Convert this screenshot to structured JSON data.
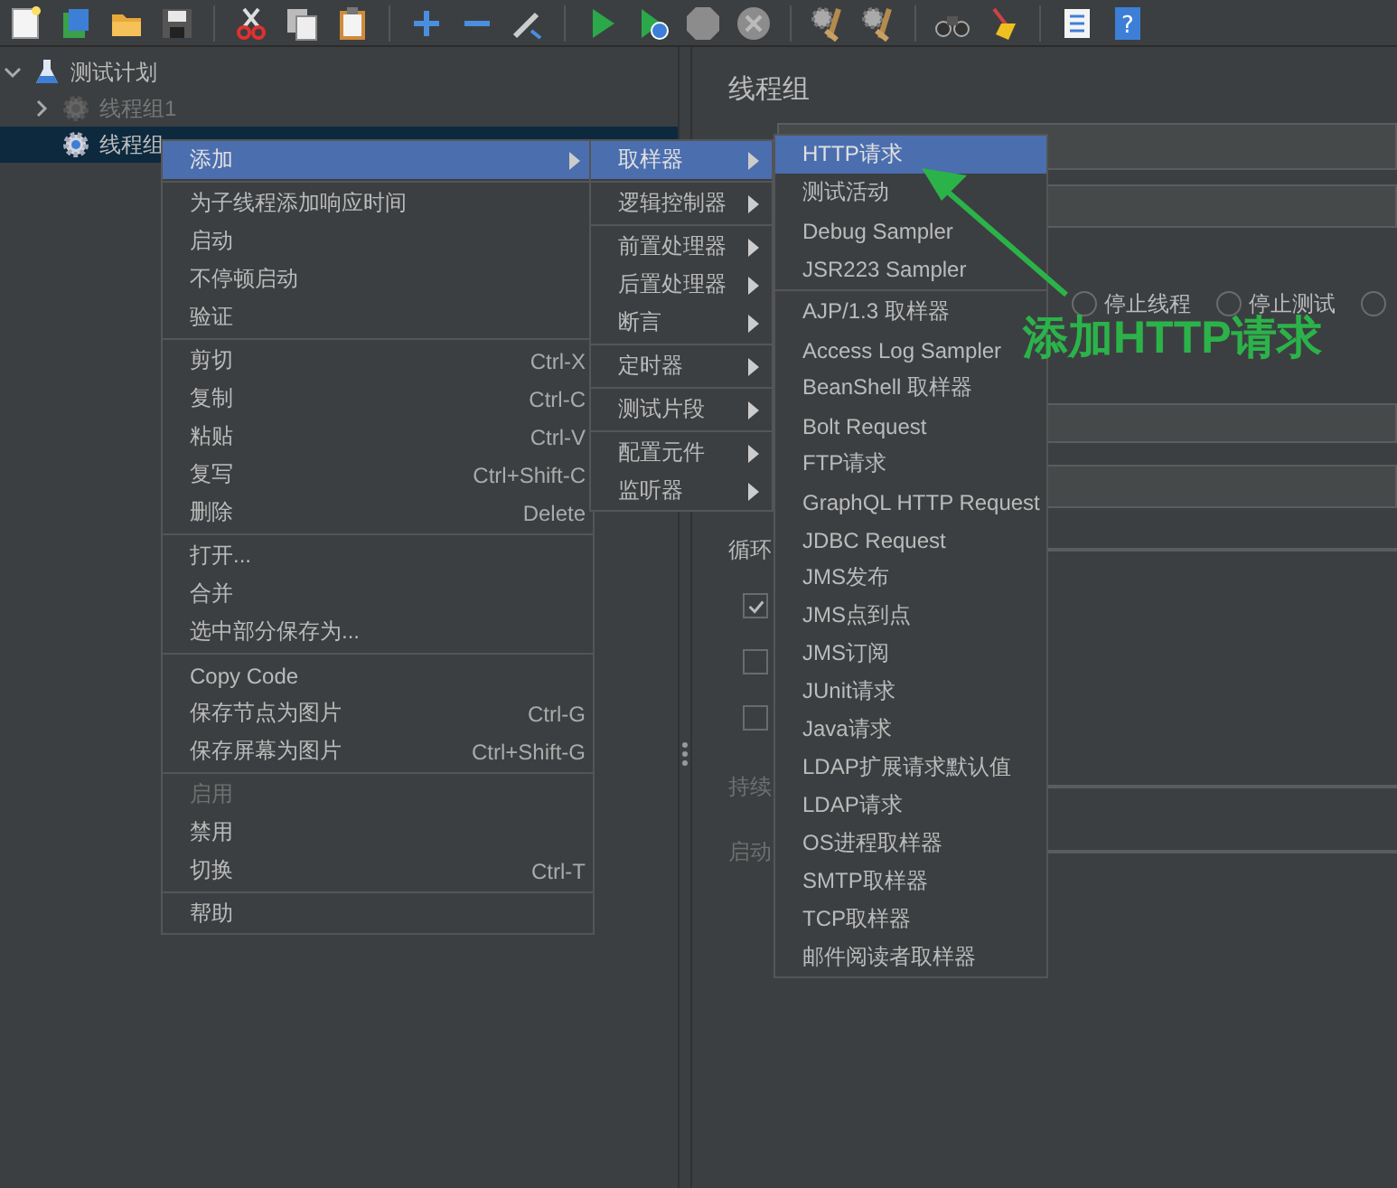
{
  "toolbar": {
    "help_glyph": "?"
  },
  "tree": [
    {
      "label": "测试计划",
      "expanded": true,
      "selected": false,
      "disabled": false,
      "children": [
        {
          "label": "线程组1",
          "expanded": false,
          "selected": false,
          "disabled": true
        },
        {
          "label": "线程组",
          "selected": true,
          "disabled": false
        }
      ]
    }
  ],
  "right_panel": {
    "title": "线程组",
    "action_options": [
      {
        "label": "停止线程",
        "selected": false
      },
      {
        "label": "停止测试",
        "selected": false
      },
      {
        "selected": false
      }
    ],
    "field_labels": [
      {
        "text": "循环",
        "disabled": false
      },
      {
        "text": "持续",
        "disabled": true
      },
      {
        "text": "启动",
        "disabled": true
      }
    ],
    "checkboxes": [
      {
        "checked": true
      },
      {
        "checked": false
      },
      {
        "checked": false
      }
    ]
  },
  "context_menus": [
    {
      "items": [
        {
          "kind": "item",
          "label": "添加",
          "submenu": true,
          "selected": true,
          "disabled": false
        },
        {
          "kind": "separator"
        },
        {
          "kind": "item",
          "label": "为子线程添加响应时间",
          "submenu": false,
          "selected": false,
          "disabled": false
        },
        {
          "kind": "item",
          "label": "启动",
          "submenu": false,
          "selected": false,
          "disabled": false
        },
        {
          "kind": "item",
          "label": "不停顿启动",
          "submenu": false,
          "selected": false,
          "disabled": false
        },
        {
          "kind": "item",
          "label": "验证",
          "submenu": false,
          "selected": false,
          "disabled": false
        },
        {
          "kind": "separator"
        },
        {
          "kind": "item",
          "label": "剪切",
          "shortcut": "Ctrl-X",
          "submenu": false,
          "selected": false,
          "disabled": false
        },
        {
          "kind": "item",
          "label": "复制",
          "shortcut": "Ctrl-C",
          "submenu": false,
          "selected": false,
          "disabled": false
        },
        {
          "kind": "item",
          "label": "粘贴",
          "shortcut": "Ctrl-V",
          "submenu": false,
          "selected": false,
          "disabled": false
        },
        {
          "kind": "item",
          "label": "复写",
          "shortcut": "Ctrl+Shift-C",
          "submenu": false,
          "selected": false,
          "disabled": false
        },
        {
          "kind": "item",
          "label": "删除",
          "shortcut": "Delete",
          "submenu": false,
          "selected": false,
          "disabled": false
        },
        {
          "kind": "separator"
        },
        {
          "kind": "item",
          "label": "打开...",
          "submenu": false,
          "selected": false,
          "disabled": false
        },
        {
          "kind": "item",
          "label": "合并",
          "submenu": false,
          "selected": false,
          "disabled": false
        },
        {
          "kind": "item",
          "label": "选中部分保存为...",
          "submenu": false,
          "selected": false,
          "disabled": false
        },
        {
          "kind": "separator"
        },
        {
          "kind": "item",
          "label": "Copy Code",
          "submenu": false,
          "selected": false,
          "disabled": false
        },
        {
          "kind": "item",
          "label": "保存节点为图片",
          "shortcut": "Ctrl-G",
          "submenu": false,
          "selected": false,
          "disabled": false
        },
        {
          "kind": "item",
          "label": "保存屏幕为图片",
          "shortcut": "Ctrl+Shift-G",
          "submenu": false,
          "selected": false,
          "disabled": false
        },
        {
          "kind": "separator"
        },
        {
          "kind": "item",
          "label": "启用",
          "submenu": false,
          "selected": false,
          "disabled": true
        },
        {
          "kind": "item",
          "label": "禁用",
          "submenu": false,
          "selected": false,
          "disabled": false
        },
        {
          "kind": "item",
          "label": "切换",
          "shortcut": "Ctrl-T",
          "submenu": false,
          "selected": false,
          "disabled": false
        },
        {
          "kind": "separator"
        },
        {
          "kind": "item",
          "label": "帮助",
          "submenu": false,
          "selected": false,
          "disabled": false
        }
      ]
    },
    {
      "items": [
        {
          "kind": "item",
          "label": "取样器",
          "submenu": true,
          "selected": true,
          "disabled": false
        },
        {
          "kind": "separator"
        },
        {
          "kind": "item",
          "label": "逻辑控制器",
          "submenu": true,
          "selected": false,
          "disabled": false
        },
        {
          "kind": "separator"
        },
        {
          "kind": "item",
          "label": "前置处理器",
          "submenu": true,
          "selected": false,
          "disabled": false
        },
        {
          "kind": "item",
          "label": "后置处理器",
          "submenu": true,
          "selected": false,
          "disabled": false
        },
        {
          "kind": "item",
          "label": "断言",
          "submenu": true,
          "selected": false,
          "disabled": false
        },
        {
          "kind": "separator"
        },
        {
          "kind": "item",
          "label": "定时器",
          "submenu": true,
          "selected": false,
          "disabled": false
        },
        {
          "kind": "separator"
        },
        {
          "kind": "item",
          "label": "测试片段",
          "submenu": true,
          "selected": false,
          "disabled": false
        },
        {
          "kind": "separator"
        },
        {
          "kind": "item",
          "label": "配置元件",
          "submenu": true,
          "selected": false,
          "disabled": false
        },
        {
          "kind": "item",
          "label": "监听器",
          "submenu": true,
          "selected": false,
          "disabled": false
        }
      ]
    },
    {
      "items": [
        {
          "kind": "item",
          "label": "HTTP请求",
          "selected": true,
          "disabled": false
        },
        {
          "kind": "item",
          "label": "测试活动",
          "selected": false,
          "disabled": false
        },
        {
          "kind": "item",
          "label": "Debug Sampler",
          "selected": false,
          "disabled": false
        },
        {
          "kind": "item",
          "label": "JSR223 Sampler",
          "selected": false,
          "disabled": false
        },
        {
          "kind": "separator"
        },
        {
          "kind": "item",
          "label": "AJP/1.3 取样器",
          "selected": false,
          "disabled": false
        },
        {
          "kind": "item",
          "label": "Access Log Sampler",
          "selected": false,
          "disabled": false
        },
        {
          "kind": "item",
          "label": "BeanShell 取样器",
          "selected": false,
          "disabled": false
        },
        {
          "kind": "item",
          "label": "Bolt Request",
          "selected": false,
          "disabled": false
        },
        {
          "kind": "item",
          "label": "FTP请求",
          "selected": false,
          "disabled": false
        },
        {
          "kind": "item",
          "label": "GraphQL HTTP Request",
          "selected": false,
          "disabled": false
        },
        {
          "kind": "item",
          "label": "JDBC Request",
          "selected": false,
          "disabled": false
        },
        {
          "kind": "item",
          "label": "JMS发布",
          "selected": false,
          "disabled": false
        },
        {
          "kind": "item",
          "label": "JMS点到点",
          "selected": false,
          "disabled": false
        },
        {
          "kind": "item",
          "label": "JMS订阅",
          "selected": false,
          "disabled": false
        },
        {
          "kind": "item",
          "label": "JUnit请求",
          "selected": false,
          "disabled": false
        },
        {
          "kind": "item",
          "label": "Java请求",
          "selected": false,
          "disabled": false
        },
        {
          "kind": "item",
          "label": "LDAP扩展请求默认值",
          "selected": false,
          "disabled": false
        },
        {
          "kind": "item",
          "label": "LDAP请求",
          "selected": false,
          "disabled": false
        },
        {
          "kind": "item",
          "label": "OS进程取样器",
          "selected": false,
          "disabled": false
        },
        {
          "kind": "item",
          "label": "SMTP取样器",
          "selected": false,
          "disabled": false
        },
        {
          "kind": "item",
          "label": "TCP取样器",
          "selected": false,
          "disabled": false
        },
        {
          "kind": "item",
          "label": "邮件阅读者取样器",
          "selected": false,
          "disabled": false
        }
      ]
    }
  ],
  "annotation": {
    "text": "添加HTTP请求"
  }
}
